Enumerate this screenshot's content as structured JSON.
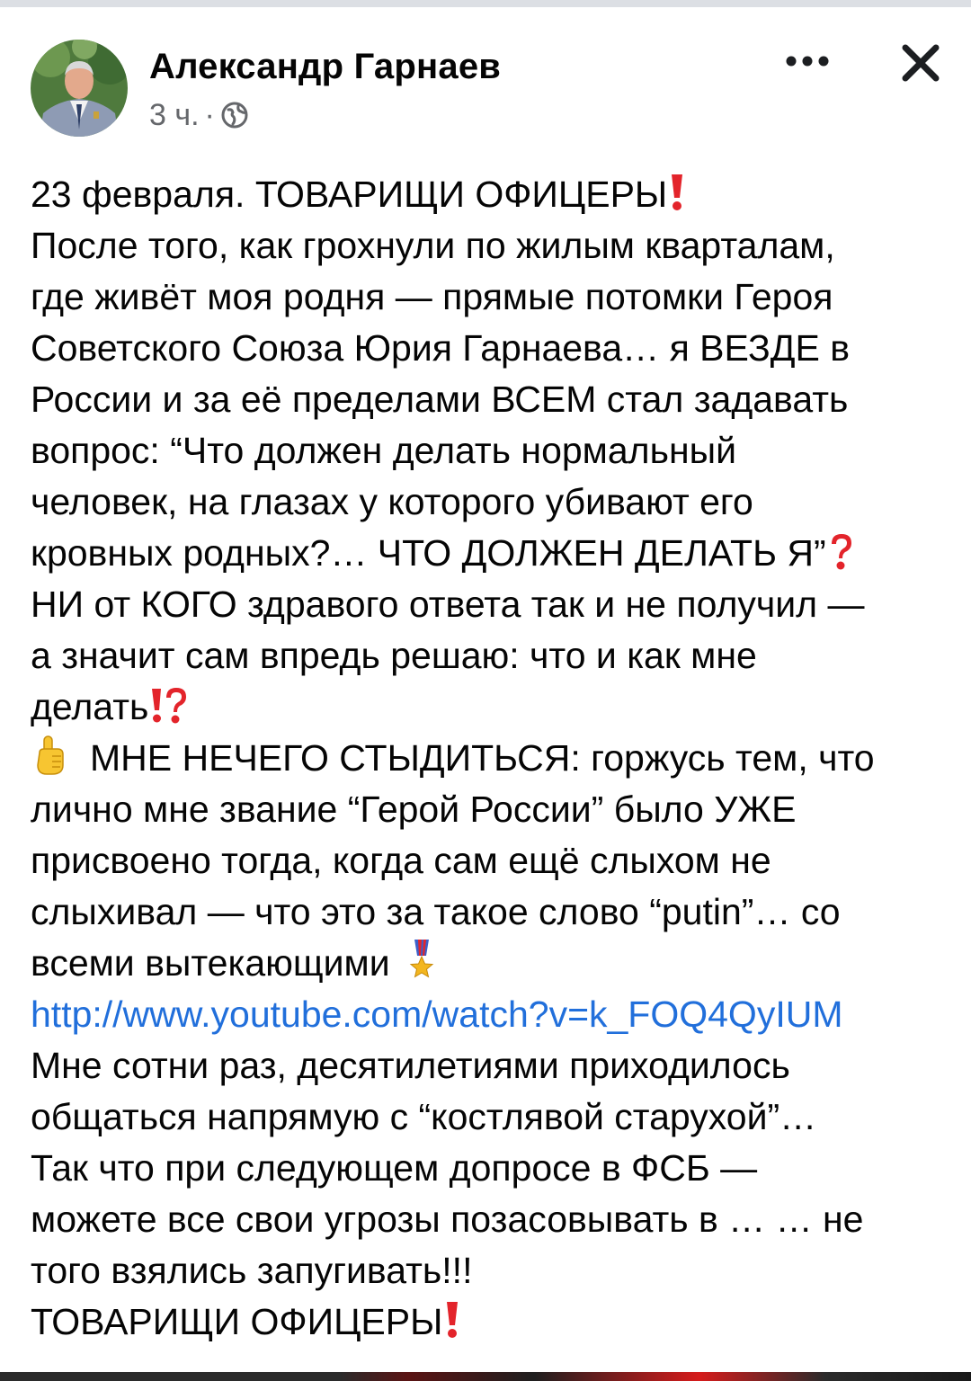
{
  "post": {
    "author_name": "Александр Гарнаев",
    "timestamp": "3 ч.",
    "separator": "·",
    "privacy_icon": "globe-icon",
    "more_icon": "more-horizontal-icon",
    "close_icon": "close-icon"
  },
  "body_lines": [
    "23 февраля. ТОВАРИЩИ ОФИЦЕРЫ",
    "После того, как грохнули по жилым кварталам,",
    "где живёт моя родня — прямые потомки Героя",
    "Советского Союза Юрия Гарнаева… я ВЕЗДЕ в",
    "России и за её пределами ВСЕМ стал задавать",
    "вопрос: “Что должен делать нормальный",
    "человек, на глазах у которого убивают его",
    "кровных родных?… ЧТО ДОЛЖЕН ДЕЛАТЬ Я”",
    "НИ от КОГО здравого ответа так и не получил —",
    "а значит сам впредь решаю: что и как мне",
    "делать",
    "МНЕ НЕЧЕГО СТЫДИТЬСЯ: горжусь тем, что",
    "лично мне звание “Герой России” было УЖЕ",
    "присвоено тогда, когда сам ещё слыхом не",
    "слыхивал — что это за такое слово “putin”… со",
    "всеми вытекающими",
    "http://www.youtube.com/watch?v=k_FOQ4QyIUM",
    "Мне сотни раз, десятилетиями приходилось",
    "общаться напрямую с “костлявой старухой”…",
    "Так что при следующем допросе в ФСБ —",
    "можете все свои угрозы позасовывать в … … не",
    "того взялись запугивать!!!",
    "ТОВАРИЩИ ОФИЦЕРЫ"
  ],
  "emojis": {
    "exclamation": "red-exclamation-icon",
    "question": "red-question-icon",
    "exclamation_question": "exclamation-question-icon",
    "pointing_up": "index-pointing-up-icon",
    "medal": "military-medal-icon"
  },
  "colors": {
    "text": "#050505",
    "meta": "#65676b",
    "link": "#216fdb",
    "emoji_red": "#e3242b"
  }
}
